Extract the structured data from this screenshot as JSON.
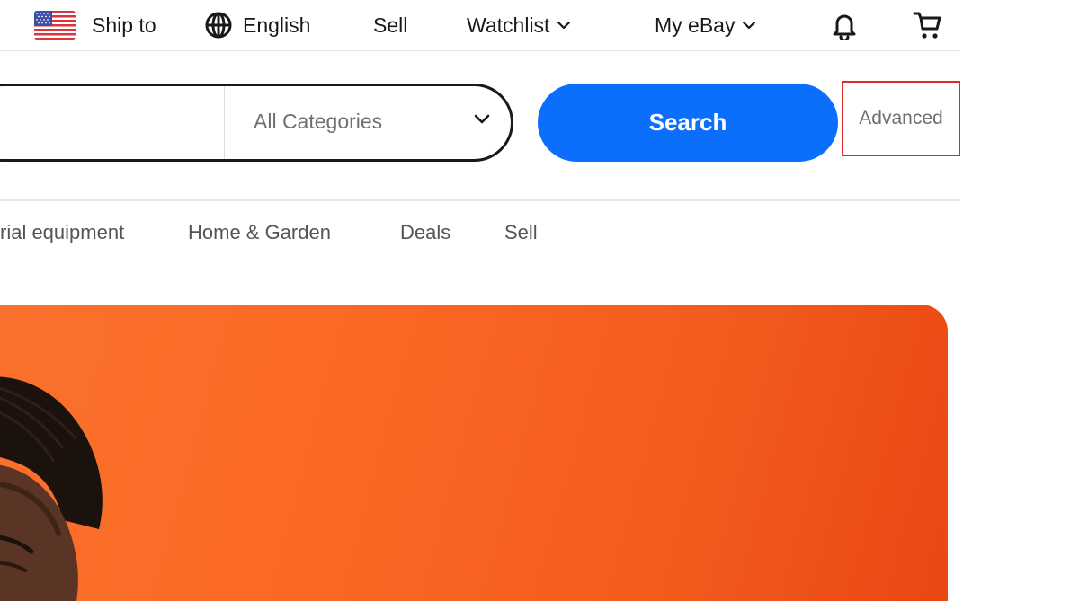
{
  "topbar": {
    "ship_to": "Ship to",
    "language": "English",
    "sell": "Sell",
    "watchlist": "Watchlist",
    "my_ebay": "My eBay"
  },
  "search": {
    "input_value": "",
    "category": "All Categories",
    "button_label": "Search",
    "advanced_label": "Advanced"
  },
  "nav": {
    "items": [
      "rial equipment",
      "Home & Garden",
      "Deals",
      "Sell"
    ]
  },
  "colors": {
    "search_button": "#0b6efd",
    "advanced_highlight": "#e0282f",
    "hero_orange": "#f9722e"
  },
  "icons": {
    "flag": "us-flag-icon",
    "language": "globe-icon",
    "notifications": "bell-icon",
    "cart": "cart-icon",
    "dropdown": "chevron-down-icon"
  }
}
